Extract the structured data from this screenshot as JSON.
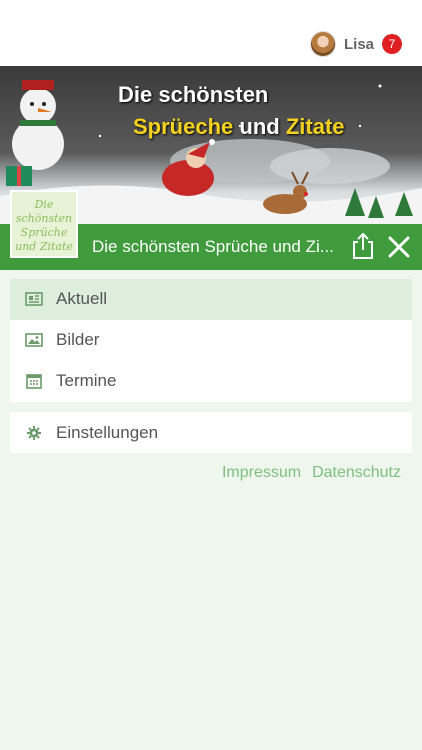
{
  "header": {
    "user_name": "Lisa",
    "notification_count": "7",
    "badge_color": "#e02020"
  },
  "banner": {
    "line1": "Die schönsten",
    "line2_word1": "Sprüeche",
    "line2_word2": "und",
    "line2_word3": "Zitate"
  },
  "app_thumb": {
    "lines": [
      "Die",
      "schönsten",
      "Sprüche",
      "und Zitate"
    ]
  },
  "titlebar": {
    "title": "Die schönsten Sprüche und Zi...",
    "background": "#3f9b3c",
    "share_icon": "share-icon",
    "close_icon": "close-icon"
  },
  "menu": {
    "items": [
      {
        "label": "Aktuell",
        "icon": "newspaper-icon",
        "active": true
      },
      {
        "label": "Bilder",
        "icon": "image-icon",
        "active": false
      },
      {
        "label": "Termine",
        "icon": "calendar-icon",
        "active": false
      }
    ],
    "settings": {
      "label": "Einstellungen",
      "icon": "gear-icon"
    }
  },
  "footer": {
    "impressum": "Impressum",
    "datenschutz": "Datenschutz"
  }
}
